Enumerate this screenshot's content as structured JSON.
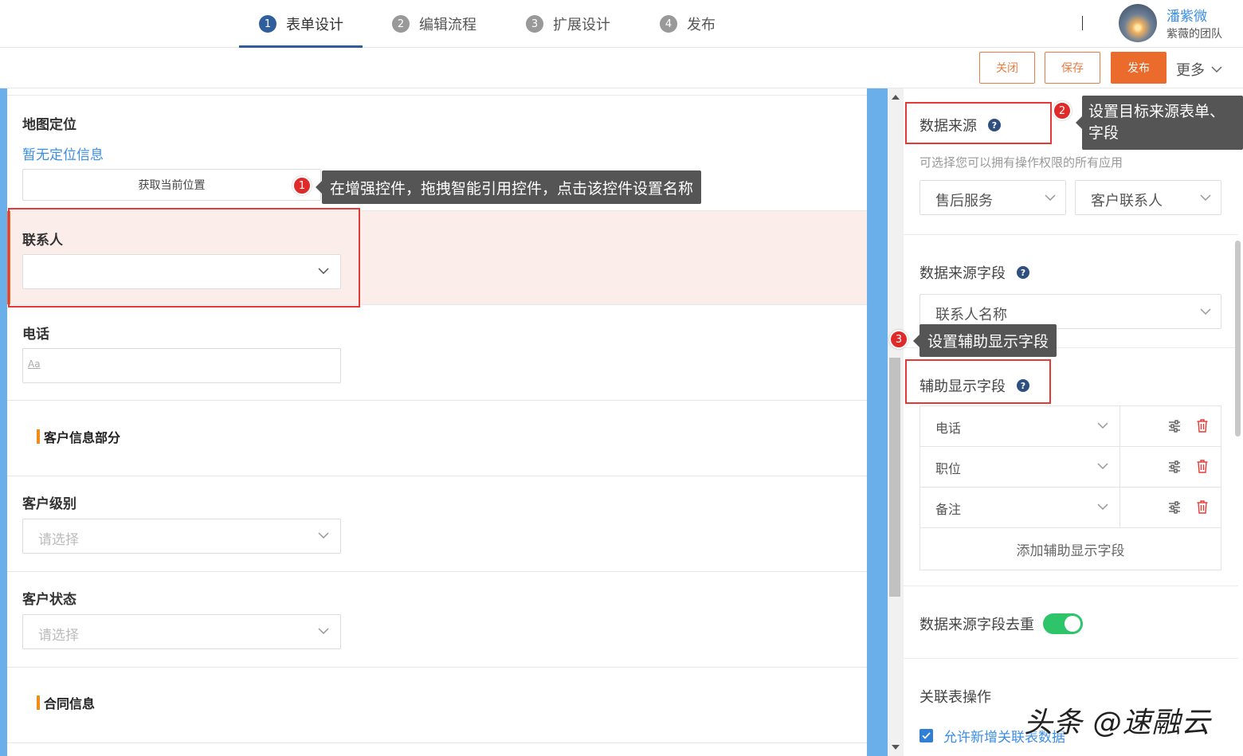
{
  "steps": [
    {
      "num": "1",
      "label": "表单设计"
    },
    {
      "num": "2",
      "label": "编辑流程"
    },
    {
      "num": "3",
      "label": "扩展设计"
    },
    {
      "num": "4",
      "label": "发布"
    }
  ],
  "user": {
    "name": "潘紫微",
    "team": "紫薇的团队"
  },
  "actions": {
    "close": "关闭",
    "save": "保存",
    "publish": "发布",
    "more": "更多"
  },
  "form": {
    "map": {
      "label": "地图定位",
      "status": "暂无定位信息",
      "button": "获取当前位置"
    },
    "contact": {
      "label": "联系人"
    },
    "phone": {
      "label": "电话",
      "placeholder": "Aa"
    },
    "section_customer": "客户信息部分",
    "level": {
      "label": "客户级别",
      "placeholder": "请选择"
    },
    "status": {
      "label": "客户状态",
      "placeholder": "请选择"
    },
    "section_contract": "合同信息"
  },
  "panel": {
    "data_source": {
      "label": "数据来源",
      "hint": "可选择您可以拥有操作权限的所有应用",
      "app": "售后服务",
      "form": "客户联系人"
    },
    "source_field": {
      "label": "数据来源字段",
      "value": "联系人名称"
    },
    "aux_fields": {
      "label": "辅助显示字段",
      "rows": [
        {
          "name": "电话"
        },
        {
          "name": "职位"
        },
        {
          "name": "备注"
        }
      ],
      "add": "添加辅助显示字段"
    },
    "dedup": {
      "label": "数据来源字段去重",
      "enabled": true
    },
    "relation": {
      "label": "关联表操作",
      "allow_add": "允许新增关联表数据",
      "allow_add_checked": true
    }
  },
  "annotations": [
    {
      "num": "1",
      "text": "在增强控件，拖拽智能引用控件，点击该控件设置名称"
    },
    {
      "num": "2",
      "text_line1": "设置目标来源表单、",
      "text_line2": "字段"
    },
    {
      "num": "3",
      "text": "设置辅助显示字段"
    }
  ],
  "watermark": "头条 @速融云",
  "colors": {
    "accent": "#ea6b2b",
    "primary_blue": "#2f5e9c",
    "link": "#3a8ee6",
    "canvas_border": "#6aaeea",
    "annotation_red": "#e53935",
    "toggle_on": "#2dc46a"
  },
  "icons": {
    "dropdown": "chevron-down-icon",
    "help": "question-circle-icon",
    "settings": "sliders-icon",
    "delete": "trash-icon"
  }
}
